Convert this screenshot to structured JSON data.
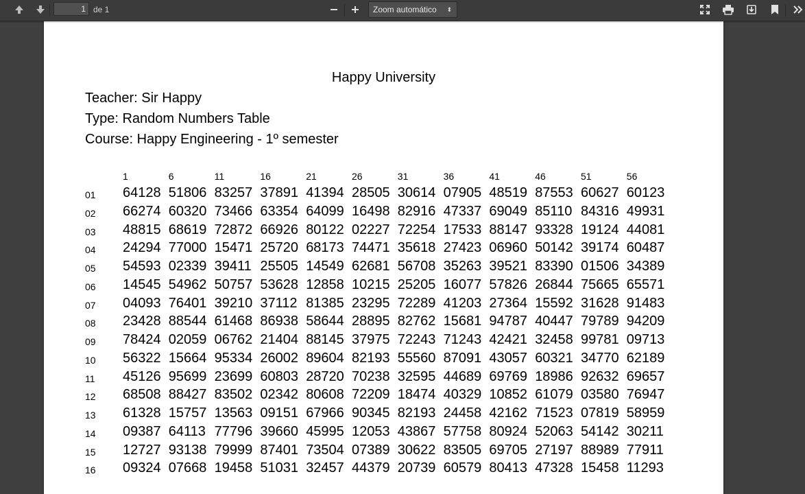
{
  "toolbar": {
    "page_current": "1",
    "page_count": "de 1",
    "zoom_label": "Zoom automático",
    "zoom_arrow": "⬍",
    "icons": [
      "arrow-up-icon",
      "arrow-down-icon",
      "minus-icon",
      "plus-icon",
      "fullscreen-icon",
      "print-icon",
      "download-icon",
      "bookmark-icon",
      "double-chevron-right-icon"
    ]
  },
  "document": {
    "title": "Happy University",
    "teacher": "Teacher: Sir Happy",
    "type": "Type: Random Numbers Table",
    "course": "Course: Happy Engineering - 1º semester",
    "column_headers": [
      "1",
      "6",
      "11",
      "16",
      "21",
      "26",
      "31",
      "36",
      "41",
      "46",
      "51",
      "56"
    ],
    "rows": [
      {
        "label": "01",
        "cells": [
          "64128",
          "51806",
          "83257",
          "37891",
          "41394",
          "28505",
          "30614",
          "07905",
          "48519",
          "87553",
          "60627",
          "60123"
        ]
      },
      {
        "label": "02",
        "cells": [
          "66274",
          "60320",
          "73466",
          "63354",
          "64099",
          "16498",
          "82916",
          "47337",
          "69049",
          "85110",
          "84316",
          "49931"
        ]
      },
      {
        "label": "03",
        "cells": [
          "48815",
          "68619",
          "72872",
          "66926",
          "80122",
          "02227",
          "72254",
          "17533",
          "88147",
          "93328",
          "19124",
          "44081"
        ]
      },
      {
        "label": "04",
        "cells": [
          "24294",
          "77000",
          "15471",
          "25720",
          "68173",
          "74471",
          "35618",
          "27423",
          "06960",
          "50142",
          "39174",
          "60487"
        ]
      },
      {
        "label": "05",
        "cells": [
          "54593",
          "02339",
          "39411",
          "25505",
          "14549",
          "62681",
          "56708",
          "35263",
          "39521",
          "83390",
          "01506",
          "34389"
        ]
      },
      {
        "label": "06",
        "cells": [
          "14545",
          "54962",
          "50757",
          "53628",
          "12858",
          "10215",
          "25205",
          "16077",
          "57826",
          "26844",
          "75665",
          "65571"
        ]
      },
      {
        "label": "07",
        "cells": [
          "04093",
          "76401",
          "39210",
          "37112",
          "81385",
          "23295",
          "72289",
          "41203",
          "27364",
          "15592",
          "31628",
          "91483"
        ]
      },
      {
        "label": "08",
        "cells": [
          "23428",
          "88544",
          "61468",
          "86938",
          "58644",
          "28895",
          "82762",
          "15681",
          "94787",
          "40447",
          "79789",
          "94209"
        ]
      },
      {
        "label": "09",
        "cells": [
          "78424",
          "02059",
          "06762",
          "21404",
          "88145",
          "37975",
          "72243",
          "71243",
          "42421",
          "32458",
          "99781",
          "09713"
        ]
      },
      {
        "label": "10",
        "cells": [
          "56322",
          "15664",
          "95334",
          "26002",
          "89604",
          "82193",
          "55560",
          "87091",
          "43057",
          "60321",
          "34770",
          "62189"
        ]
      },
      {
        "label": "11",
        "cells": [
          "45126",
          "95699",
          "23699",
          "60803",
          "28720",
          "70238",
          "32595",
          "44689",
          "69769",
          "18986",
          "92632",
          "69657"
        ]
      },
      {
        "label": "12",
        "cells": [
          "68508",
          "88427",
          "83502",
          "02342",
          "80608",
          "72209",
          "18474",
          "40329",
          "10852",
          "61079",
          "03580",
          "76947"
        ]
      },
      {
        "label": "13",
        "cells": [
          "61328",
          "15757",
          "13563",
          "09151",
          "67966",
          "90345",
          "82193",
          "24458",
          "42162",
          "71523",
          "07819",
          "58959"
        ]
      },
      {
        "label": "14",
        "cells": [
          "09387",
          "64113",
          "77796",
          "39660",
          "45995",
          "12053",
          "43867",
          "57758",
          "80924",
          "52063",
          "54142",
          "30211"
        ]
      },
      {
        "label": "15",
        "cells": [
          "12727",
          "93138",
          "79999",
          "87401",
          "73504",
          "07389",
          "30622",
          "83505",
          "69705",
          "27197",
          "88989",
          "77911"
        ]
      },
      {
        "label": "16",
        "cells": [
          "09324",
          "07668",
          "19458",
          "51031",
          "32457",
          "44379",
          "20739",
          "60579",
          "80413",
          "47328",
          "15458",
          "11293"
        ]
      }
    ]
  }
}
